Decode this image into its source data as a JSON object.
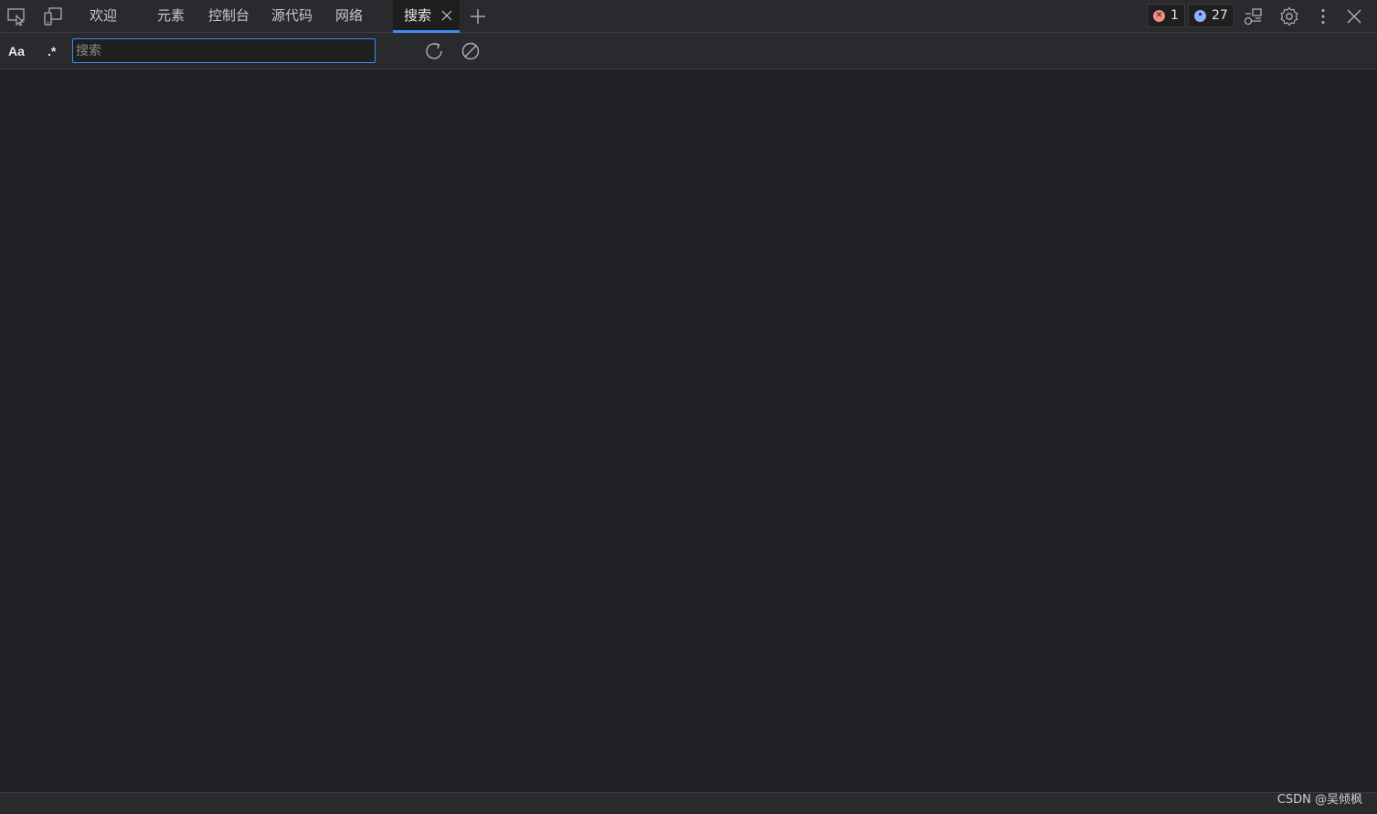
{
  "tabbar": {
    "tabs": [
      {
        "label": "欢迎"
      },
      {
        "label": "元素"
      },
      {
        "label": "控制台"
      },
      {
        "label": "源代码"
      },
      {
        "label": "网络"
      },
      {
        "label": "搜索",
        "active": true
      }
    ],
    "errors_count": "1",
    "messages_count": "27"
  },
  "search": {
    "case_sensitive_label": "Aa",
    "regex_label": ".*",
    "placeholder": "搜索",
    "value": ""
  },
  "watermark": "CSDN @吴倾枫",
  "colors": {
    "background": "#202124",
    "toolbar": "#292a2d",
    "accent": "#3b8eea",
    "error": "#f28b82",
    "info": "#8ab4f8"
  }
}
